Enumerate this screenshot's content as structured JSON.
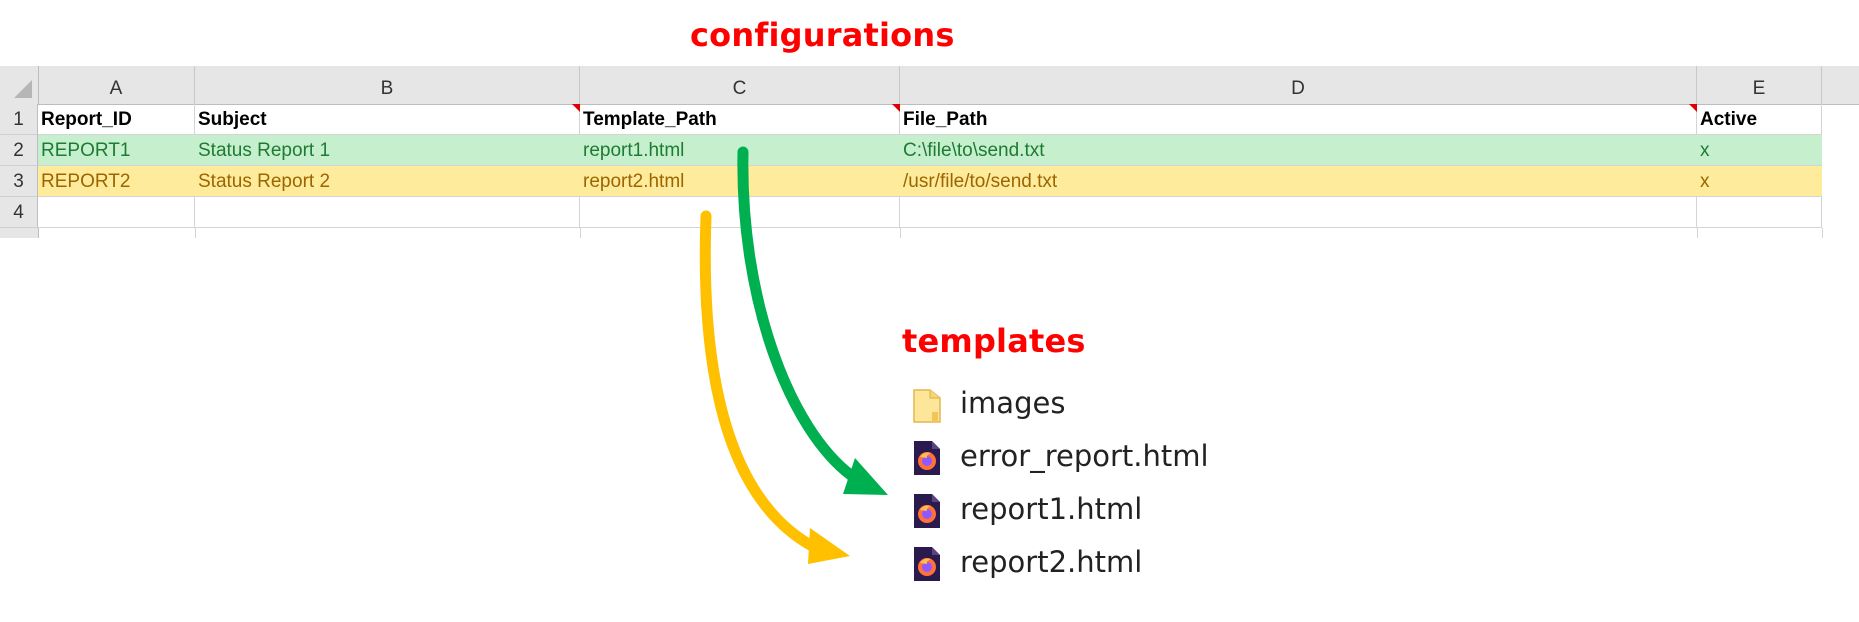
{
  "headings": {
    "configurations": "configurations",
    "templates": "templates"
  },
  "spreadsheet": {
    "columns": [
      "A",
      "B",
      "C",
      "D",
      "E"
    ],
    "row_numbers": [
      "1",
      "2",
      "3",
      "4"
    ],
    "header": [
      "Report_ID",
      "Subject",
      "Template_Path",
      "File_Path",
      "Active"
    ],
    "rows": [
      {
        "style": "green",
        "cells": [
          "REPORT1",
          "Status Report 1",
          "report1.html",
          "C:\\file\\to\\send.txt",
          "x"
        ]
      },
      {
        "style": "yellow",
        "cells": [
          "REPORT2",
          "Status Report 2",
          "report2.html",
          "/usr/file/to/send.txt",
          "x"
        ]
      },
      {
        "style": "empty",
        "cells": [
          "",
          "",
          "",
          "",
          ""
        ]
      }
    ],
    "colors": {
      "green_fill": "#c6efce",
      "green_text": "#1e7b34",
      "yellow_fill": "#ffeb9c",
      "yellow_text": "#9c6500"
    }
  },
  "templates_folder": {
    "items": [
      {
        "name": "images",
        "icon": "folder-icon"
      },
      {
        "name": "error_report.html",
        "icon": "firefox-html-icon"
      },
      {
        "name": "report1.html",
        "icon": "firefox-html-icon"
      },
      {
        "name": "report2.html",
        "icon": "firefox-html-icon"
      }
    ]
  },
  "arrows": {
    "green": {
      "color": "#00b050",
      "from": "report1.html",
      "to": "report1.html"
    },
    "yellow": {
      "color": "#ffc000",
      "from": "report2.html",
      "to": "report2.html"
    }
  }
}
